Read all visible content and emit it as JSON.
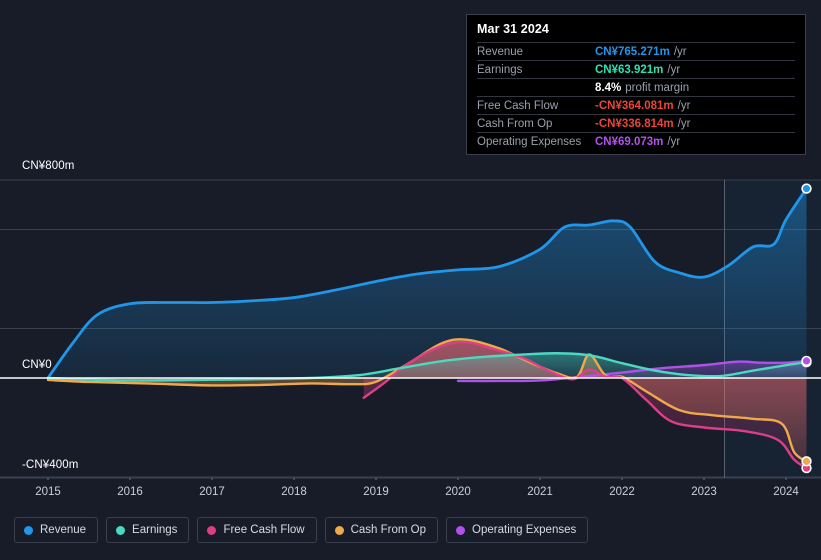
{
  "chart_data": {
    "type": "area",
    "title": "",
    "xlabel": "",
    "ylabel": "",
    "currency": "CN¥",
    "grid": true,
    "legend_position": "bottom-left",
    "xlim": [
      2014.6,
      2024.4
    ],
    "ylim": [
      -480,
      880
    ],
    "y_ticks": [
      {
        "label": "CN¥800m",
        "value": 800
      },
      {
        "label": "CN¥0",
        "value": 0
      },
      {
        "label": "-CN¥400m",
        "value": -400
      }
    ],
    "x_ticks": [
      "2015",
      "2016",
      "2017",
      "2018",
      "2019",
      "2020",
      "2021",
      "2022",
      "2023",
      "2024"
    ],
    "forecast_divider_year": 2023.25,
    "series": [
      {
        "name": "Revenue",
        "color": "#2196e8",
        "x": [
          2015.0,
          2015.3,
          2015.6,
          2016.0,
          2016.5,
          2017.0,
          2017.5,
          2018.0,
          2018.5,
          2019.0,
          2019.5,
          2020.0,
          2020.5,
          2021.0,
          2021.3,
          2021.6,
          2021.9,
          2022.1,
          2022.4,
          2022.7,
          2023.0,
          2023.3,
          2023.6,
          2023.85,
          2024.0,
          2024.25
        ],
        "values": [
          0,
          140,
          255,
          300,
          305,
          305,
          312,
          325,
          355,
          390,
          420,
          437,
          450,
          520,
          610,
          618,
          635,
          610,
          470,
          425,
          408,
          455,
          530,
          540,
          640,
          765.271
        ]
      },
      {
        "name": "Earnings",
        "color": "#4dd9c0",
        "x": [
          2015.0,
          2015.5,
          2016.0,
          2016.8,
          2017.5,
          2018.2,
          2018.8,
          2019.3,
          2019.8,
          2020.3,
          2020.8,
          2021.2,
          2021.6,
          2022.0,
          2022.4,
          2022.8,
          2023.2,
          2023.6,
          2024.0,
          2024.25
        ],
        "values": [
          0,
          -6,
          -10,
          -8,
          -5,
          0,
          12,
          40,
          68,
          85,
          95,
          100,
          92,
          60,
          30,
          12,
          8,
          30,
          52,
          63.921
        ]
      },
      {
        "name": "Free Cash Flow",
        "color": "#dd3f87",
        "x": [
          2018.85,
          2019.1,
          2019.4,
          2019.8,
          2020.1,
          2020.4,
          2020.8,
          2021.1,
          2021.4,
          2021.6,
          2021.8,
          2022.0,
          2022.3,
          2022.6,
          2023.0,
          2023.5,
          2023.9,
          2024.1,
          2024.25
        ],
        "values": [
          -80,
          -20,
          60,
          130,
          145,
          120,
          80,
          30,
          -5,
          35,
          5,
          0,
          -90,
          -175,
          -200,
          -215,
          -250,
          -330,
          -364.081
        ]
      },
      {
        "name": "Cash From Op",
        "color": "#f0a84c",
        "x": [
          2015.0,
          2015.5,
          2016.2,
          2017.0,
          2017.6,
          2018.2,
          2018.7,
          2019.0,
          2019.4,
          2019.8,
          2020.1,
          2020.5,
          2020.9,
          2021.2,
          2021.45,
          2021.6,
          2021.8,
          2022.0,
          2022.3,
          2022.7,
          2023.1,
          2023.6,
          2023.95,
          2024.1,
          2024.25
        ],
        "values": [
          -8,
          -16,
          -22,
          -30,
          -28,
          -22,
          -25,
          -15,
          60,
          140,
          155,
          120,
          60,
          20,
          4,
          95,
          10,
          5,
          -55,
          -130,
          -150,
          -165,
          -185,
          -300,
          -336.814
        ]
      },
      {
        "name": "Operating Expenses",
        "color": "#b052e8",
        "x": [
          2020.0,
          2020.5,
          2021.0,
          2021.5,
          2022.0,
          2022.5,
          2023.0,
          2023.4,
          2023.7,
          2024.0,
          2024.25
        ],
        "values": [
          -12,
          -12,
          -10,
          5,
          22,
          40,
          52,
          66,
          62,
          62,
          69.073
        ]
      }
    ]
  },
  "tooltip": {
    "date": "Mar 31 2024",
    "rows": [
      {
        "key": "Revenue",
        "value": "CN¥765.271m",
        "suffix": "/yr",
        "color": "#2196e8"
      },
      {
        "key": "Earnings",
        "value": "CN¥63.921m",
        "suffix": "/yr",
        "color": "#2ee0b4"
      },
      {
        "key": "",
        "value": "8.4%",
        "suffix": "profit margin",
        "color": "#ffffff"
      },
      {
        "key": "Free Cash Flow",
        "value": "-CN¥364.081m",
        "suffix": "/yr",
        "color": "#e8463c"
      },
      {
        "key": "Cash From Op",
        "value": "-CN¥336.814m",
        "suffix": "/yr",
        "color": "#e8463c"
      },
      {
        "key": "Operating Expenses",
        "value": "CN¥69.073m",
        "suffix": "/yr",
        "color": "#b052e8"
      }
    ]
  },
  "legend": {
    "items": [
      {
        "label": "Revenue",
        "color": "#2196e8"
      },
      {
        "label": "Earnings",
        "color": "#4dd9c0"
      },
      {
        "label": "Free Cash Flow",
        "color": "#dd3f87"
      },
      {
        "label": "Cash From Op",
        "color": "#f0a84c"
      },
      {
        "label": "Operating Expenses",
        "color": "#b052e8"
      }
    ]
  }
}
